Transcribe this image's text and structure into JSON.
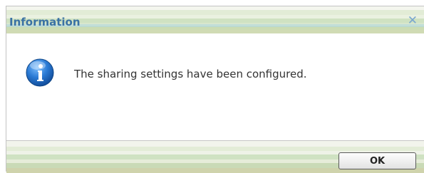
{
  "dialog": {
    "title": "Information",
    "close_icon": "close-icon",
    "icon": "info-icon",
    "message": "The sharing settings have been configured.",
    "ok_label": "OK"
  },
  "colors": {
    "title": "#3a72a4",
    "close": "#7aa7cf",
    "icon_blue": "#2b7bd0"
  }
}
